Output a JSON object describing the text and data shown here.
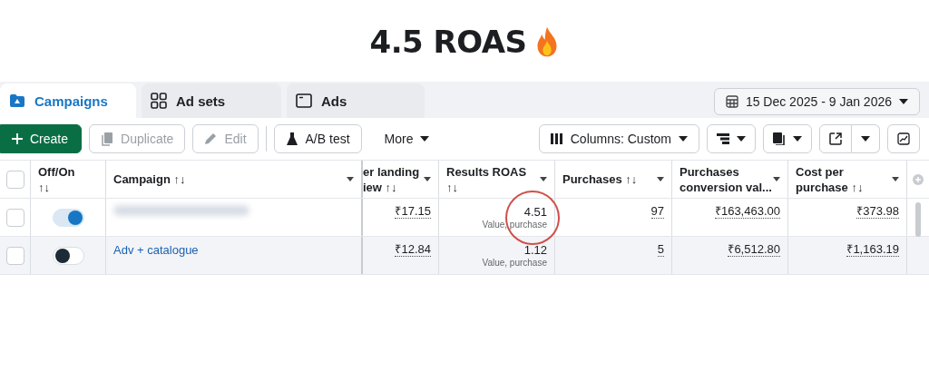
{
  "headline": {
    "text": "4.5 ROAS"
  },
  "tabs": [
    {
      "label": "Campaigns",
      "selected": true
    },
    {
      "label": "Ad sets",
      "selected": false
    },
    {
      "label": "Ads",
      "selected": false
    }
  ],
  "date_range": "15 Dec 2025 - 9 Jan 2026",
  "toolbar": [
    {
      "label": "Create",
      "kind": "primary",
      "disabled": false
    },
    {
      "label": "Duplicate",
      "kind": "duplicate",
      "disabled": true
    },
    {
      "label": "Edit",
      "kind": "edit",
      "disabled": true
    },
    {
      "label": "A/B test",
      "kind": "abtest",
      "disabled": false
    },
    {
      "label": "More",
      "kind": "more",
      "disabled": false
    }
  ],
  "columns_button": "Columns: Custom",
  "table": {
    "select_all_checked": false,
    "columns": [
      {
        "lines": [
          "Off/On",
          "↑↓"
        ]
      },
      {
        "lines": [
          "Campaign ↑↓"
        ]
      },
      {
        "lines": [
          "er landing",
          "iew ↑↓"
        ]
      },
      {
        "lines": [
          "Results ROAS",
          "↑↓"
        ]
      },
      {
        "lines": [
          "Purchases ↑↓"
        ]
      },
      {
        "lines": [
          "Purchases",
          "conversion val..."
        ]
      },
      {
        "lines": [
          "Cost per",
          "purchase ↑↓"
        ]
      }
    ],
    "rows": [
      {
        "checked": false,
        "on": true,
        "redacted": true,
        "campaign": null,
        "landing": "₹17.15",
        "roas": "4.51",
        "roas_note": "Value, purchase",
        "highlighted": true,
        "purchases": "97",
        "conv_value": "₹163,463.00",
        "cost": "₹373.98"
      },
      {
        "checked": false,
        "on": false,
        "redacted": false,
        "campaign": "Adv + catalogue",
        "landing": "₹12.84",
        "roas": "1.12",
        "roas_note": "Value, purchase",
        "highlighted": false,
        "purchases": "5",
        "conv_value": "₹6,512.80",
        "cost": "₹1,163.19"
      }
    ]
  }
}
